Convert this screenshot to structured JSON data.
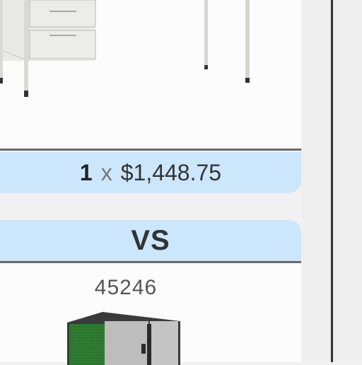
{
  "comparison": {
    "top_item": {
      "image_alt": "white desk with drawers",
      "quantity": "1",
      "times_symbol": "x",
      "price": "$1,448.75"
    },
    "vs_label": "VS",
    "bottom_item": {
      "product_id": "45246",
      "image_alt": "storage cabinet with green panel"
    }
  },
  "colors": {
    "highlight_bar": "#cce6fb",
    "divider": "#6b6b6b",
    "cabinet_green": "#2e7d32"
  }
}
